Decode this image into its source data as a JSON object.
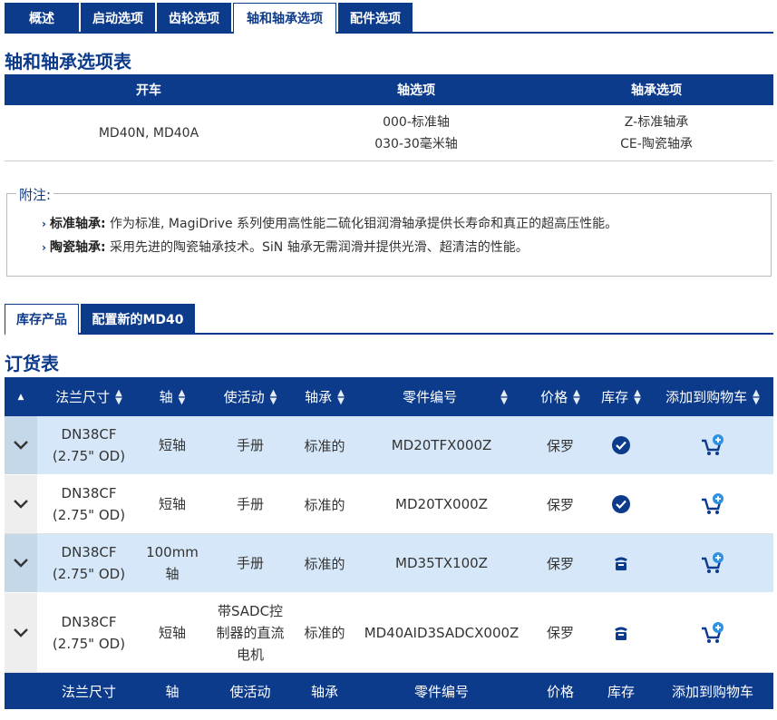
{
  "top_tabs": [
    "概述",
    "启动选项",
    "齿轮选项",
    "轴和轴承选项",
    "配件选项"
  ],
  "options_section": {
    "title": "轴和轴承选项表",
    "headers": [
      "开车",
      "轴选项",
      "轴承选项"
    ],
    "row": {
      "drive": "MD40N, MD40A",
      "shaft_1": "000-标准轴",
      "shaft_2": "030-30毫米轴",
      "bearing_1": "Z-标准轴承",
      "bearing_2": "CE-陶瓷轴承"
    }
  },
  "notes": {
    "legend": "附注:",
    "items": [
      {
        "term": "标准轴承:",
        "text": " 作为标准, MagiDrive 系列使用高性能二硫化钼润滑轴承提供长寿命和真正的超高压性能。"
      },
      {
        "term": "陶瓷轴承:",
        "text": "  采用先进的陶瓷轴承技术。SiN 轴承无需润滑并提供光滑、超清洁的性能。"
      }
    ]
  },
  "product_tabs": [
    "库存产品",
    "配置新的MD40"
  ],
  "order_section": {
    "title": "订货表",
    "headers": [
      "法兰尺寸",
      "轴",
      "使活动",
      "轴承",
      "零件编号",
      "价格",
      "库存",
      "添加到购物车"
    ],
    "rows": [
      {
        "flange_1": "DN38CF",
        "flange_2": "(2.75\" OD)",
        "shaft_1": "短轴",
        "shaft_2": "",
        "drive_1": "手册",
        "drive_2": "",
        "drive_3": "",
        "bearing": "标准的",
        "part": "MD20TFX000Z",
        "price": "保罗",
        "stock": "check"
      },
      {
        "flange_1": "DN38CF",
        "flange_2": "(2.75\" OD)",
        "shaft_1": "短轴",
        "shaft_2": "",
        "drive_1": "手册",
        "drive_2": "",
        "drive_3": "",
        "bearing": "标准的",
        "part": "MD20TX000Z",
        "price": "保罗",
        "stock": "check"
      },
      {
        "flange_1": "DN38CF",
        "flange_2": "(2.75\" OD)",
        "shaft_1": "100mm",
        "shaft_2": "轴",
        "drive_1": "手册",
        "drive_2": "",
        "drive_3": "",
        "bearing": "标准的",
        "part": "MD35TX100Z",
        "price": "保罗",
        "stock": "phone"
      },
      {
        "flange_1": "DN38CF",
        "flange_2": "(2.75\" OD)",
        "shaft_1": "短轴",
        "shaft_2": "",
        "drive_1": "带SADC控",
        "drive_2": "制器的直流",
        "drive_3": "电机",
        "bearing": "标准的",
        "part": "MD40AID3SADCX000Z",
        "price": "保罗",
        "stock": "phone"
      }
    ]
  },
  "colors": {
    "navy": "#0c3b8c",
    "row_alt": "#d5e7f8",
    "expander": "#c5d8ea"
  },
  "icons": {
    "expand": "chevron-down-icon",
    "in_stock": "check-circle-icon",
    "call": "phone-icon",
    "cart": "add-to-cart-icon",
    "sort": "sort-arrows-icon"
  }
}
